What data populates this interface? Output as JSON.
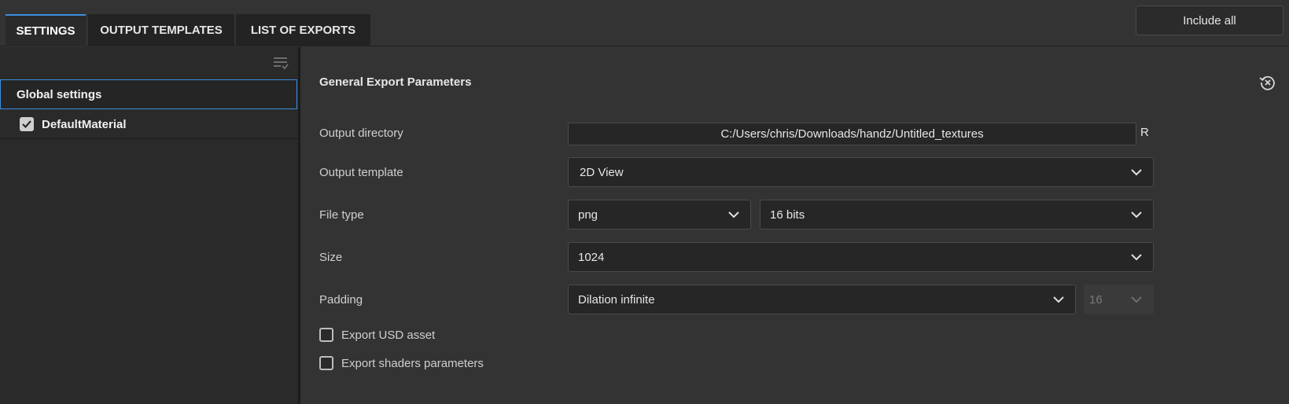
{
  "tabs": [
    {
      "label": "SETTINGS"
    },
    {
      "label": "OUTPUT TEMPLATES"
    },
    {
      "label": "LIST OF EXPORTS"
    }
  ],
  "header": {
    "include_all_label": "Include all"
  },
  "sidebar": {
    "global_label": "Global settings",
    "material_label": "DefaultMaterial",
    "material_checked": true
  },
  "section": {
    "title": "General Export Parameters"
  },
  "fields": {
    "output_directory": {
      "label": "Output directory",
      "value": "C:/Users/chris/Downloads/handz/Untitled_textures",
      "reset": "R"
    },
    "output_template": {
      "label": "Output template",
      "value": "2D View"
    },
    "file_type": {
      "label": "File type",
      "format": "png",
      "bits": "16 bits"
    },
    "size": {
      "label": "Size",
      "value": "1024"
    },
    "padding": {
      "label": "Padding",
      "value": "Dilation infinite",
      "amount": "16"
    }
  },
  "options": {
    "export_usd": {
      "label": "Export USD asset",
      "checked": false
    },
    "export_shaders": {
      "label": "Export shaders parameters",
      "checked": false
    }
  },
  "colors": {
    "accent": "#3d8ee0",
    "panel": "#2a2a2a",
    "background": "#333333"
  }
}
